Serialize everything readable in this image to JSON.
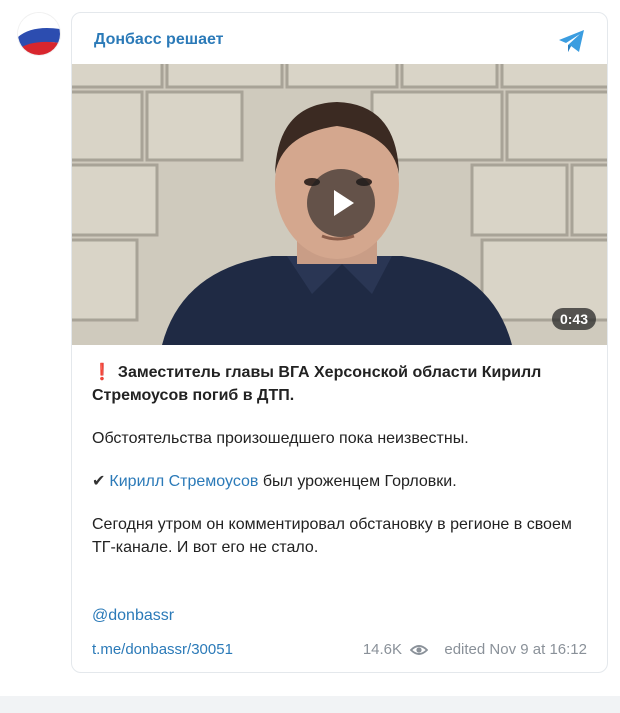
{
  "channel": {
    "name": "Донбасс решает",
    "avatar": "russian-flag-avatar",
    "brand_color": "#2b7ab8"
  },
  "video": {
    "duration": "0:43",
    "play_icon": "play-icon"
  },
  "post": {
    "headline_prefix": "❗",
    "headline": "Заместитель главы ВГА Херсонской области Кирилл Стремоусов погиб в ДТП.",
    "para2": "Обстоятельства произошедшего пока неизвестны.",
    "para3_prefix": "✔",
    "para3_link": "Кирилл Стремоусов",
    "para3_rest": " был уроженцем Горловки.",
    "para4": "Сегодня утром он комментировал обстановку в регионе в своем ТГ-канале. И вот его не стало.",
    "handle": "@donbassr"
  },
  "footer": {
    "post_link": "t.me/donbassr/30051",
    "views": "14.6K",
    "edited": "edited",
    "date": "Nov 9 at 16:12"
  }
}
